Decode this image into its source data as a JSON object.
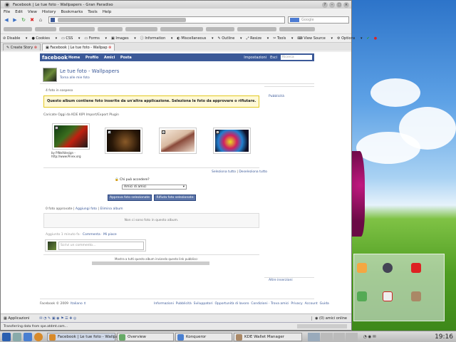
{
  "window": {
    "title": "Facebook | Le tue foto - Wallpapers - Gran Paradiso"
  },
  "menu": [
    "File",
    "Edit",
    "View",
    "History",
    "Bookmarks",
    "Tools",
    "Help"
  ],
  "search_placeholder": "Google",
  "webdev": [
    "Disable",
    "Cookies",
    "CSS",
    "Forms",
    "Images",
    "Information",
    "Miscellaneous",
    "Outline",
    "Resize",
    "Tools",
    "View Source",
    "Options"
  ],
  "tabs": [
    {
      "label": "Create Story"
    },
    {
      "label": "Facebook | Le tue foto - Wallpap"
    }
  ],
  "fb": {
    "logo": "facebook",
    "nav": [
      "Home",
      "Profilo",
      "Amici",
      "Posta"
    ],
    "right": [
      "Impostazioni",
      "Esci"
    ],
    "search_placeholder": "Ricerca"
  },
  "album": {
    "title": "Le tue foto - Wallpapers",
    "back_link": "Torna alle mie foto",
    "pending_count": "4 foto in sospeso",
    "notice": "Questo album contiene foto inserite da un'altra applicazione. Seleziona le foto da approvare o rifiutare.",
    "uploaded_via": "Caricate Oggi da KDE KIPI Import/Export Plugin",
    "photo_caption": [
      "by PiNeXdesign -",
      "http://www.Pinex.org"
    ],
    "select_all": "Seleziona tutto",
    "deselect_all": "Deseleziona tutto",
    "who_label": "Chi può accedere?",
    "who_value": "Amici di amici",
    "approve_btn": "Approva foto selezionate",
    "reject_btn": "Rifiuta foto selezionate",
    "approved_count": "0 foto approvate",
    "add_photos": "Aggiungi foto",
    "delete_album": "Elimina album",
    "empty_msg": "Non ci sono foto in questo album.",
    "added_time": "Aggiunto 1 minuto fa",
    "comment": "Commenta",
    "like": "Mi piace",
    "comment_placeholder": "Scrivi un commento...",
    "share_text": "Mostra a tutti questo album inviando questo link pubblico:"
  },
  "sidebar": {
    "publicity": "Pubblicità",
    "more_ads": "Altre inserzioni"
  },
  "footer": {
    "copyright": "Facebook © 2009",
    "language": "Italiano",
    "links": [
      "Informazioni",
      "Pubblicità",
      "Sviluppatori",
      "Opportunità di lavoro",
      "Condizioni",
      "Trova amici",
      "Privacy",
      "Account",
      "Guida"
    ]
  },
  "chatbar": {
    "apps": "Applicazioni",
    "online": "(0) amici online"
  },
  "status": "Transferring data from spe.atdmt.com...",
  "taskbar": {
    "items": [
      "Facebook | Le tue foto - Wallpape",
      "Overview",
      "Konqueror",
      "KDE Wallet Manager"
    ],
    "clock": "19:16"
  }
}
